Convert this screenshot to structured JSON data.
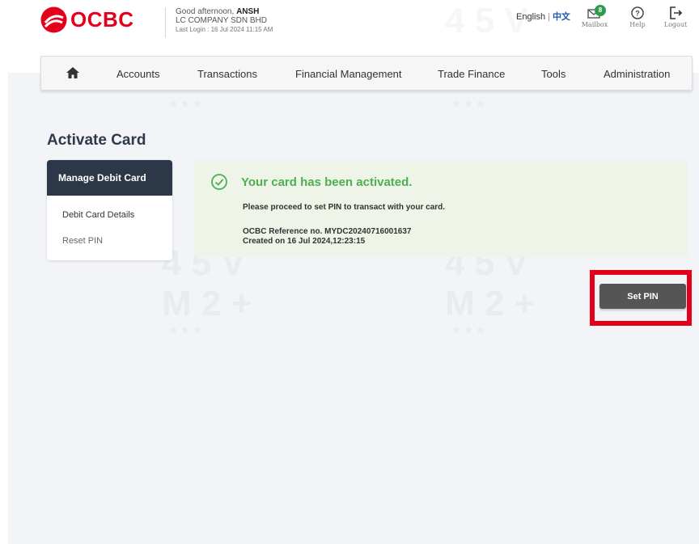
{
  "header": {
    "brand": "OCBC",
    "greeting_prefix": "Good afternoon, ",
    "user_name": "ANSH",
    "company": "LC COMPANY SDN BHD",
    "last_login": "Last Login : 16 Jul 2024 11:15 AM",
    "lang_en": "English",
    "lang_sep": "|",
    "lang_zh": "中文",
    "mailbox_label": "Mailbox",
    "mailbox_count": "8",
    "help_label": "Help",
    "logout_label": "Logout"
  },
  "nav": {
    "items": [
      "Accounts",
      "Transactions",
      "Financial Management",
      "Trade Finance",
      "Tools",
      "Administration"
    ]
  },
  "page": {
    "title": "Activate Card"
  },
  "sidebar": {
    "heading": "Manage Debit Card",
    "items": [
      "Debit Card Details",
      "Reset PIN"
    ]
  },
  "success": {
    "title": "Your card has been activated.",
    "message": "Please proceed to set PIN to transact with your card.",
    "reference": "OCBC Reference no. MYDC20240716001637",
    "created": "Created on 16 Jul 2024,12:23:15"
  },
  "actions": {
    "set_pin_label": "Set PIN"
  },
  "colors": {
    "brand_red": "#e3001b",
    "nav_dark": "#2c3747",
    "success_green": "#4caf50",
    "highlight_red": "#e2001a"
  }
}
